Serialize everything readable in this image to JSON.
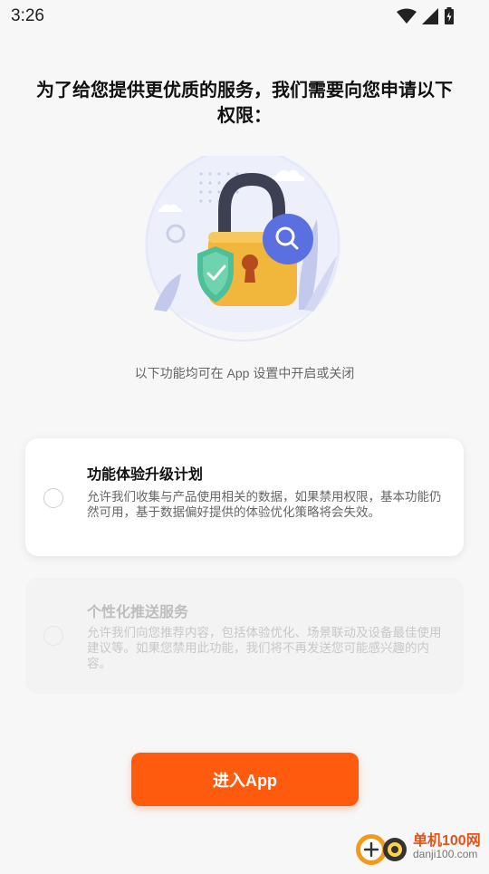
{
  "status_bar": {
    "time": "3:26"
  },
  "header": {
    "title": "为了给您提供更优质的服务，我们需要向您申请以下权限："
  },
  "subtitle": "以下功能均可在 App 设置中开启或关闭",
  "permissions": [
    {
      "title": "功能体验升级计划",
      "description": "允许我们收集与产品使用相关的数据，如果禁用权限，基本功能仍然可用，基于数据偏好提供的体验优化策略将会失效。",
      "checked": false
    },
    {
      "title": "个性化推送服务",
      "description": "允许我们向您推荐内容，包括体验优化、场景联动及设备最佳使用建议等。如果您禁用此功能，我们将不再发送您可能感兴趣的内容。",
      "checked": false,
      "disabled": true
    }
  ],
  "enter_button": {
    "label": "进入App"
  },
  "watermark": {
    "name": "单机100网",
    "url": "danji100.com"
  },
  "colors": {
    "accent": "#ff5b0f",
    "background": "#f7f7f7",
    "lock": "#f0b73c",
    "shield": "#4fbf9a",
    "search": "#5a6fe0"
  }
}
